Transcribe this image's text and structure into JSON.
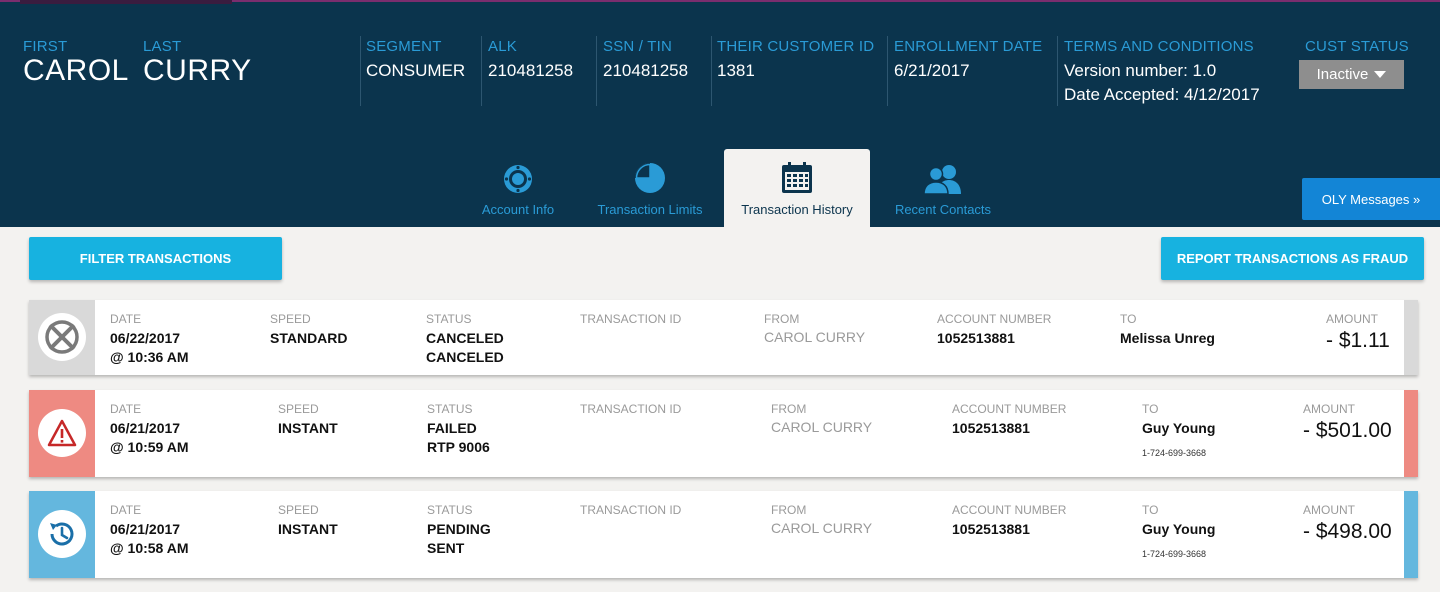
{
  "customer": {
    "first_label": "FIRST",
    "first_name": "CAROL",
    "last_label": "LAST",
    "last_name": "CURRY",
    "segment_label": "SEGMENT",
    "segment": "CONSUMER",
    "alk_label": "ALK",
    "alk": "210481258",
    "ssn_label": "SSN / TIN",
    "ssn": "210481258",
    "their_id_label": "THEIR CUSTOMER ID",
    "their_id": "1381",
    "enroll_label": "ENROLLMENT DATE",
    "enroll_date": "6/21/2017",
    "terms_label": "TERMS AND CONDITIONS",
    "terms_version": "Version number: 1.0",
    "terms_accepted": "Date Accepted: 4/12/2017",
    "status_label": "CUST STATUS",
    "status_value": "Inactive"
  },
  "tabs": [
    {
      "label": "Account Info",
      "icon": "gear-circle-icon"
    },
    {
      "label": "Transaction Limits",
      "icon": "pie-chart-icon"
    },
    {
      "label": "Transaction History",
      "icon": "calendar-icon",
      "active": true
    },
    {
      "label": "Recent Contacts",
      "icon": "people-icon"
    }
  ],
  "oly_button": "OLY Messages »",
  "actions": {
    "filter": "FILTER TRANSACTIONS",
    "fraud": "REPORT TRANSACTIONS AS FRAUD"
  },
  "labels": {
    "date": "DATE",
    "speed": "SPEED",
    "status": "STATUS",
    "txn_id": "TRANSACTION ID",
    "from": "FROM",
    "account": "ACCOUNT NUMBER",
    "to": "TO",
    "amount": "AMOUNT"
  },
  "transactions": [
    {
      "date": "06/22/2017",
      "time": "@ 10:36 AM",
      "speed": "STANDARD",
      "status": "CANCELED",
      "status_detail": "CANCELED",
      "txn_id": "",
      "from": "CAROL CURRY",
      "account": "1052513881",
      "to": "Melissa Unreg",
      "phone": "",
      "amount": "- $1.11",
      "color": "#d9d9d9",
      "icon": "cancel-icon"
    },
    {
      "date": "06/21/2017",
      "time": "@ 10:59 AM",
      "speed": "INSTANT",
      "status": "FAILED",
      "status_detail": "RTP 9006",
      "txn_id": "",
      "from": "CAROL CURRY",
      "account": "1052513881",
      "to": "Guy Young",
      "phone": "1-724-699-3668",
      "amount": "- $501.00",
      "color": "#ee8a82",
      "icon": "warning-icon"
    },
    {
      "date": "06/21/2017",
      "time": "@ 10:58 AM",
      "speed": "INSTANT",
      "status": "PENDING",
      "status_detail": "SENT",
      "txn_id": "",
      "from": "CAROL CURRY",
      "account": "1052513881",
      "to": "Guy Young",
      "phone": "1-724-699-3668",
      "amount": "- $498.00",
      "color": "#64b7de",
      "icon": "clock-icon"
    }
  ]
}
